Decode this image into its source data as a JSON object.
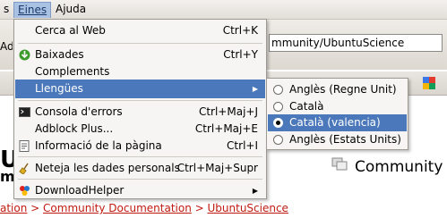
{
  "menubar": {
    "partial_left": "s",
    "eines": "Eines",
    "ajuda": "Ajuda"
  },
  "url": {
    "partial_address_label": "Adr",
    "value": "mmunity/UbuntuScience"
  },
  "page": {
    "heading_partial": "U",
    "sub_partial": "m",
    "community": "Community",
    "breadcrumb": {
      "part1": "ation",
      "sep": " > ",
      "part2": "Community Documentation",
      "part3": "UbuntuScience"
    }
  },
  "eines_menu": {
    "cerca": {
      "label": "Cerca al Web",
      "accel": "Ctrl+K"
    },
    "baixades": {
      "label": "Baixades",
      "accel": "Ctrl+Y"
    },
    "complements": {
      "label": "Complements"
    },
    "llengues": {
      "label": "Llengües"
    },
    "consola": {
      "label": "Consola d'errors",
      "accel": "Ctrl+Maj+J"
    },
    "adblock": {
      "label": "Adblock Plus...",
      "accel": "Ctrl+Maj+E"
    },
    "informacio": {
      "label": "Informació de la pàgina",
      "accel": "Ctrl+I"
    },
    "neteja": {
      "label": "Neteja les dades personals",
      "accel": "Ctrl+Maj+Supr"
    },
    "downloadhelper": {
      "label": "DownloadHelper"
    }
  },
  "llengues_submenu": {
    "items": [
      {
        "label": "Anglès (Regne Unit)",
        "selected": false
      },
      {
        "label": "Català",
        "selected": false
      },
      {
        "label": "Català (valencia)",
        "selected": true
      },
      {
        "label": "Anglès (Estats Units)",
        "selected": false
      }
    ]
  },
  "colors": {
    "highlight": "#4b78ba",
    "link": "#c01a10"
  }
}
